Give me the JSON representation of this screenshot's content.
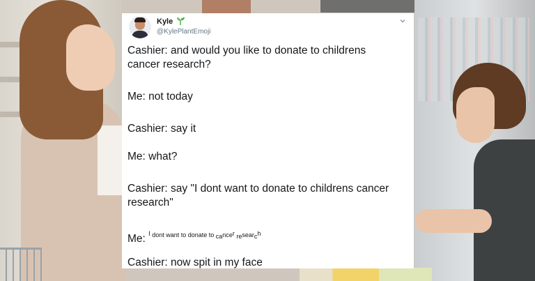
{
  "tweet": {
    "display_name": "Kyle",
    "handle": "@KylePlantEmoji",
    "name_emoji": "sprout-icon",
    "lines": {
      "l1": "Cashier: and would you like to donate to childrens",
      "l2": "cancer research?",
      "l3": "Me: not today",
      "l4": "Cashier: say it",
      "l5": "Me: what?",
      "l6": "Cashier: say \"I dont want to donate to childrens cancer",
      "l7": "research\"",
      "l8_prefix": "Me:",
      "l8_tiny": {
        "a": "I",
        "b": "dont want to donate to",
        "c": "c",
        "d": "a",
        "e": "nc",
        "f": "e",
        "g": "r",
        "h": "r",
        "i": "e",
        "j": "s",
        "k": "e",
        "l": "a",
        "m": "r",
        "n": "c",
        "o": "h"
      },
      "l9": "Cashier: now spit in my face"
    }
  },
  "colors": {
    "text": "#14171a",
    "handle": "#657786",
    "card": "#ffffff",
    "sprout": "#4caf50"
  }
}
